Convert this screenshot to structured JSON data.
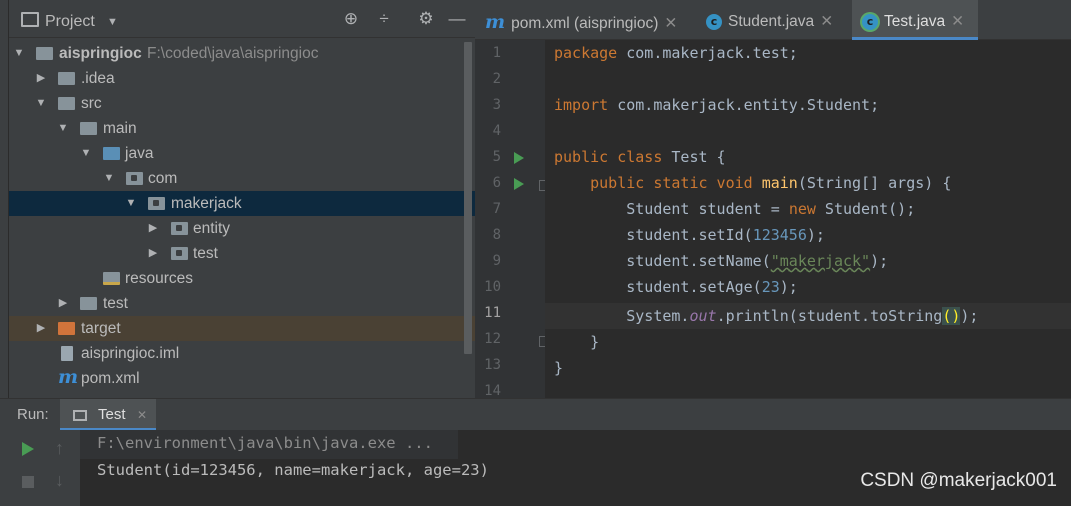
{
  "project": {
    "title": "Project",
    "tree": [
      {
        "label": "aispringioc",
        "path": "F:\\coded\\java\\aispringioc"
      },
      {
        "label": ".idea"
      },
      {
        "label": "src"
      },
      {
        "label": "main"
      },
      {
        "label": "java"
      },
      {
        "label": "com"
      },
      {
        "label": "makerjack"
      },
      {
        "label": "entity"
      },
      {
        "label": "test"
      },
      {
        "label": "resources"
      },
      {
        "label": "test"
      },
      {
        "label": "target"
      },
      {
        "label": "aispringioc.iml"
      },
      {
        "label": "pom.xml"
      }
    ]
  },
  "editor": {
    "tabs": [
      {
        "label": "pom.xml (aispringioc)",
        "icon": "m"
      },
      {
        "label": "Student.java",
        "icon": "C"
      },
      {
        "label": "Test.java",
        "icon": "C"
      }
    ],
    "line_numbers": [
      "1",
      "2",
      "3",
      "4",
      "5",
      "6",
      "7",
      "8",
      "9",
      "10",
      "11",
      "12",
      "13",
      "14"
    ],
    "code": {
      "l1_kw": "package",
      "l1_rest": " com.makerjack.test;",
      "l3_kw": "import",
      "l3_rest": " com.makerjack.entity.Student;",
      "l5_kw": "public class",
      "l5_rest": " Test {",
      "l6_kw": "public static void",
      "l6_fn": "main",
      "l6_rest": "(String[] args) {",
      "l7_a": "Student student = ",
      "l7_kw": "new",
      "l7_b": " Student();",
      "l8_a": "student.setId(",
      "l8_num": "123456",
      "l8_b": ");",
      "l9_a": "student.setName(",
      "l9_str": "\"makerjack\"",
      "l9_b": ");",
      "l10_a": "student.setAge(",
      "l10_num": "23",
      "l10_b": ");",
      "l11_a": "System.",
      "l11_fld": "out",
      "l11_b": ".println(student.toString",
      "l11_paren": "()",
      "l11_c": ");",
      "l12": "}",
      "l13": "}"
    }
  },
  "run": {
    "label": "Run:",
    "tab": "Test",
    "line1": "F:\\environment\\java\\bin\\java.exe ...",
    "line2": "Student(id=123456, name=makerjack, age=23)"
  },
  "watermark": "CSDN @makerjack001",
  "colors": {
    "keyword": "#cc7832",
    "number": "#6897bb",
    "string": "#6a8759",
    "field": "#9876aa",
    "function": "#ffc66d"
  }
}
